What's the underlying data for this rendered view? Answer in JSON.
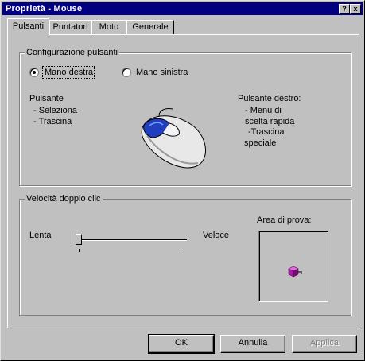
{
  "window": {
    "title": "Proprietà - Mouse",
    "help_glyph": "?",
    "close_glyph": "x"
  },
  "tabs": [
    {
      "label": "Pulsanti",
      "active": true
    },
    {
      "label": "Puntatori",
      "active": false
    },
    {
      "label": "Moto",
      "active": false
    },
    {
      "label": "Generale",
      "active": false
    }
  ],
  "button_config": {
    "group_title": "Configurazione pulsanti",
    "options": [
      {
        "label": "Mano destra",
        "checked": true
      },
      {
        "label": "Mano sinistra",
        "checked": false
      }
    ],
    "left_desc": {
      "heading": "Pulsante",
      "lines": [
        "- Seleziona",
        "- Trascina"
      ]
    },
    "right_desc": {
      "heading": "Pulsante destro:",
      "lines": [
        "- Menu di",
        "scelta rapida",
        "-Trascina",
        "speciale"
      ]
    },
    "mouse_icon": "mouse-icon",
    "accent_color": "#1f3fbf"
  },
  "double_click": {
    "group_title": "Velocità doppio clic",
    "slow_label": "Lenta",
    "fast_label": "Veloce",
    "slider_fraction": 0,
    "test_area_label": "Area di prova:",
    "test_icon": "jack-in-the-box-icon",
    "test_icon_color": "#a020a0"
  },
  "buttons": {
    "ok": "OK",
    "cancel": "Annulla",
    "apply": "Applica"
  }
}
